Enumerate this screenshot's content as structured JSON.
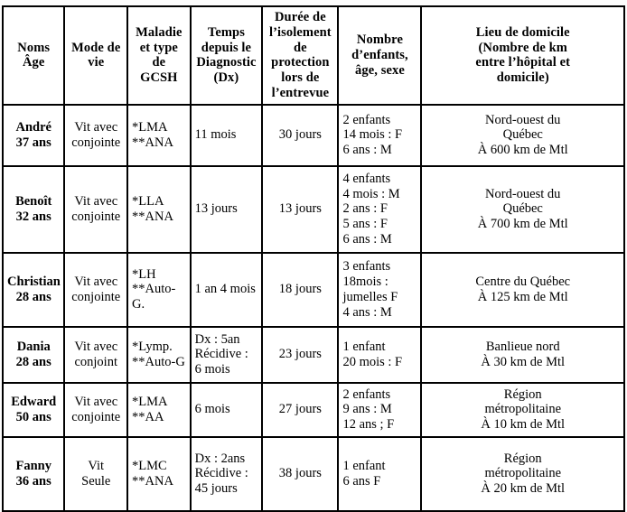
{
  "table": {
    "caption": "",
    "columns": [
      {
        "id": "noms-age",
        "lines": [
          "Noms",
          "Âge"
        ]
      },
      {
        "id": "mode-de-vie",
        "lines": [
          "Mode de",
          "vie"
        ]
      },
      {
        "id": "maladie-type-gcsh",
        "lines": [
          "Maladie",
          "et type de",
          "GCSH"
        ]
      },
      {
        "id": "temps-depuis-dx",
        "lines": [
          "Temps",
          "depuis le",
          "Diagnostic",
          "(Dx)"
        ]
      },
      {
        "id": "duree-isolement",
        "lines": [
          "Durée de",
          "l’isolement",
          "de protection",
          "lors de",
          "l’entrevue"
        ]
      },
      {
        "id": "nombre-enfants",
        "lines": [
          "Nombre",
          "d’enfants,",
          "âge, sexe"
        ]
      },
      {
        "id": "lieu-domicile",
        "lines": [
          "Lieu de domicile",
          "(Nombre de km",
          "entre l’hôpital et",
          "domicile)"
        ]
      }
    ],
    "rows": [
      {
        "id": "row-andre",
        "name": [
          "André",
          "37 ans"
        ],
        "mode_de_vie": [
          "Vit avec",
          "conjointe"
        ],
        "maladie": [
          "*LMA",
          "**ANA"
        ],
        "temps_dx": [
          "11 mois"
        ],
        "duree_isolement": [
          "30 jours"
        ],
        "enfants": [
          "2 enfants",
          "14 mois : F",
          "6 ans : M"
        ],
        "domicile": [
          "Nord-ouest du",
          "Québec",
          "À 600 km de Mtl"
        ]
      },
      {
        "id": "row-benoit",
        "name": [
          "Benoît",
          "32 ans"
        ],
        "mode_de_vie": [
          "Vit avec",
          "conjointe"
        ],
        "maladie": [
          "*LLA",
          "**ANA"
        ],
        "temps_dx": [
          "13 jours"
        ],
        "duree_isolement": [
          "13 jours"
        ],
        "enfants": [
          "4 enfants",
          "4 mois : M",
          "2 ans : F",
          "5 ans : F",
          "6 ans : M"
        ],
        "domicile": [
          "Nord-ouest du",
          "Québec",
          "À 700 km de Mtl"
        ]
      },
      {
        "id": "row-christian",
        "name": [
          "Christian",
          "28 ans"
        ],
        "mode_de_vie": [
          "Vit avec",
          "conjointe"
        ],
        "maladie": [
          "*LH",
          "**Auto-",
          "G."
        ],
        "temps_dx": [
          "1 an 4 mois"
        ],
        "duree_isolement": [
          "18 jours"
        ],
        "enfants": [
          "3 enfants",
          "18mois :",
          "jumelles F",
          "4 ans : M"
        ],
        "domicile": [
          "Centre du Québec",
          "À 125 km de Mtl"
        ]
      },
      {
        "id": "row-dania",
        "name": [
          "Dania",
          "28 ans"
        ],
        "mode_de_vie": [
          "Vit avec",
          "conjoint"
        ],
        "maladie": [
          "*Lymp.",
          "**Auto-G"
        ],
        "temps_dx": [
          "Dx : 5an",
          "Récidive :",
          "6 mois"
        ],
        "duree_isolement": [
          "23 jours"
        ],
        "enfants": [
          "1 enfant",
          "20 mois : F"
        ],
        "domicile": [
          "Banlieue nord",
          "À 30 km de Mtl"
        ]
      },
      {
        "id": "row-edward",
        "name": [
          "Edward",
          "50 ans"
        ],
        "mode_de_vie": [
          "Vit avec",
          "conjointe"
        ],
        "maladie": [
          "*LMA",
          "**AA"
        ],
        "temps_dx": [
          "6 mois"
        ],
        "duree_isolement": [
          "27 jours"
        ],
        "enfants": [
          "2 enfants",
          "9 ans : M",
          "12 ans ; F"
        ],
        "domicile": [
          "Région",
          "métropolitaine",
          "À 10 km de Mtl"
        ]
      },
      {
        "id": "row-fanny",
        "name": [
          "Fanny",
          "36 ans"
        ],
        "mode_de_vie": [
          "Vit",
          "Seule"
        ],
        "maladie": [
          "*LMC",
          "**ANA"
        ],
        "temps_dx": [
          "Dx : 2ans",
          "Récidive :",
          "45 jours"
        ],
        "duree_isolement": [
          "38 jours"
        ],
        "enfants": [
          "1 enfant",
          "6 ans F"
        ],
        "domicile": [
          "Région",
          "métropolitaine",
          "À 20 km de Mtl"
        ]
      }
    ]
  },
  "colors": {
    "border": "#000000",
    "text": "#000000",
    "background": "#ffffff"
  }
}
